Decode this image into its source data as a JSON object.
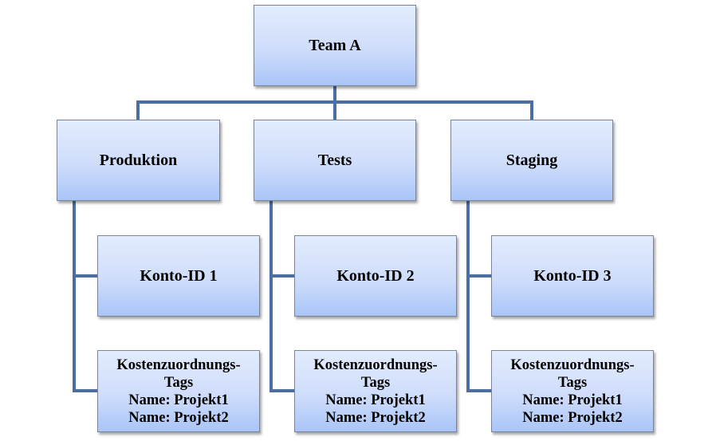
{
  "diagram": {
    "root": {
      "label": "Team A"
    },
    "environments": [
      {
        "label": "Produktion",
        "account": {
          "label": "Konto-ID 1"
        },
        "tags": {
          "title_line1": "Kostenzuordnungs-",
          "title_line2": "Tags",
          "items": [
            "Name: Projekt1",
            "Name: Projekt2"
          ]
        }
      },
      {
        "label": "Tests",
        "account": {
          "label": "Konto-ID 2"
        },
        "tags": {
          "title_line1": "Kostenzuordnungs-",
          "title_line2": "Tags",
          "items": [
            "Name: Projekt1",
            "Name: Projekt2"
          ]
        }
      },
      {
        "label": "Staging",
        "account": {
          "label": "Konto-ID 3"
        },
        "tags": {
          "title_line1": "Kostenzuordnungs-",
          "title_line2": "Tags",
          "items": [
            "Name: Projekt1",
            "Name: Projekt2"
          ]
        }
      }
    ],
    "colors": {
      "connector": "#4a6fa0",
      "box_top": "#e3ecfe",
      "box_bottom": "#a9c5f8",
      "box_border": "#7b8597"
    }
  }
}
